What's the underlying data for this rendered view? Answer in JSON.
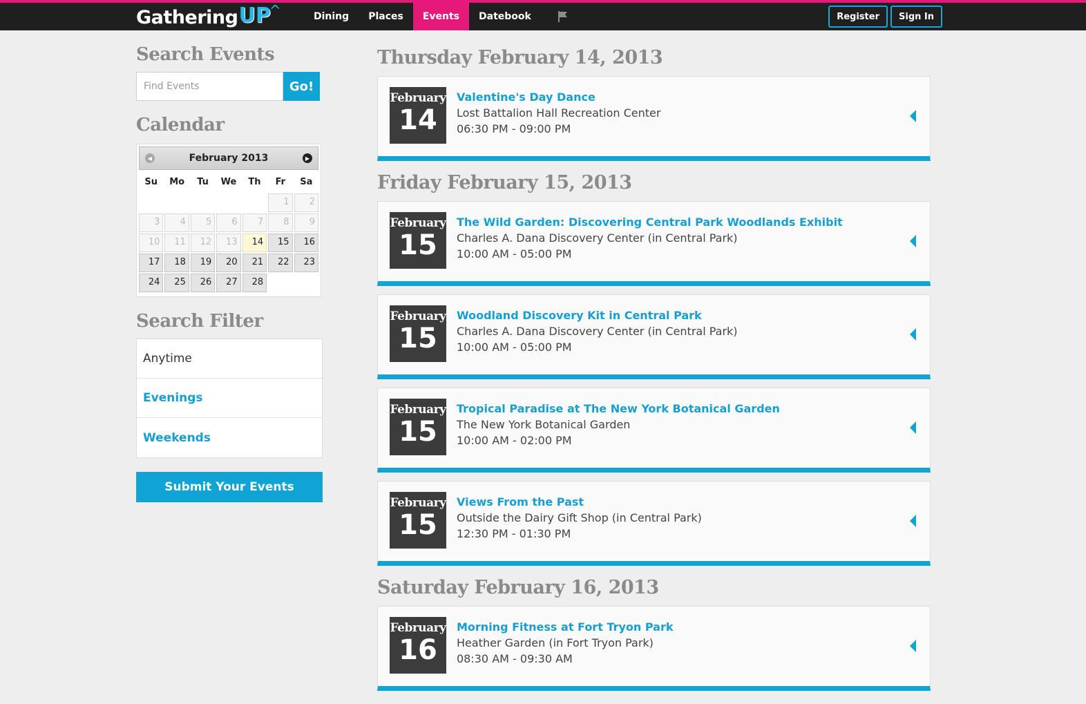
{
  "header": {
    "logo_main": "Gathering",
    "logo_accent": "UP",
    "nav": [
      {
        "label": "Dining"
      },
      {
        "label": "Places"
      },
      {
        "label": "Events"
      },
      {
        "label": "Datebook"
      }
    ],
    "register": "Register",
    "sign_in": "Sign In"
  },
  "sidebar": {
    "search_heading": "Search Events",
    "search_placeholder": "Find Events",
    "go_label": "Go!",
    "calendar_heading": "Calendar",
    "calendar": {
      "month_label": "February 2013",
      "weekdays": [
        "Su",
        "Mo",
        "Tu",
        "We",
        "Th",
        "Fr",
        "Sa"
      ],
      "cells": [
        "",
        "",
        "",
        "",
        "",
        "1",
        "2",
        "3",
        "4",
        "5",
        "6",
        "7",
        "8",
        "9",
        "10",
        "11",
        "12",
        "13",
        "14",
        "15",
        "16",
        "17",
        "18",
        "19",
        "20",
        "21",
        "22",
        "23",
        "24",
        "25",
        "26",
        "27",
        "28",
        "",
        ""
      ],
      "today": "14"
    },
    "filter_heading": "Search Filter",
    "filters": [
      {
        "label": "Anytime"
      },
      {
        "label": "Evenings"
      },
      {
        "label": "Weekends"
      }
    ],
    "submit_label": "Submit Your Events"
  },
  "days": [
    {
      "heading": "Thursday February 14, 2013",
      "events": [
        {
          "month": "February",
          "day": "14",
          "title": "Valentine's Day Dance",
          "venue": "Lost Battalion Hall Recreation Center",
          "time": "06:30 PM - 09:00 PM"
        }
      ]
    },
    {
      "heading": "Friday February 15, 2013",
      "events": [
        {
          "month": "February",
          "day": "15",
          "title": "The Wild Garden: Discovering Central Park Woodlands Exhibit",
          "venue": "Charles A. Dana Discovery Center (in Central Park)",
          "time": "10:00 AM - 05:00 PM"
        },
        {
          "month": "February",
          "day": "15",
          "title": "Woodland Discovery Kit in Central Park",
          "venue": "Charles A. Dana Discovery Center (in Central Park)",
          "time": "10:00 AM - 05:00 PM"
        },
        {
          "month": "February",
          "day": "15",
          "title": "Tropical Paradise at The New York Botanical Garden",
          "venue": "The New York Botanical Garden",
          "time": "10:00 AM - 02:00 PM"
        },
        {
          "month": "February",
          "day": "15",
          "title": "Views From the Past",
          "venue": "Outside the Dairy Gift Shop (in Central Park)",
          "time": "12:30 PM - 01:30 PM"
        }
      ]
    },
    {
      "heading": "Saturday February 16, 2013",
      "events": [
        {
          "month": "February",
          "day": "16",
          "title": "Morning Fitness at Fort Tryon Park",
          "venue": "Heather Garden (in Fort Tryon Park)",
          "time": "08:30 AM - 09:30 AM"
        }
      ]
    }
  ],
  "colors": {
    "brand_pink": "#e5197a",
    "brand_blue": "#0fa4d4"
  }
}
